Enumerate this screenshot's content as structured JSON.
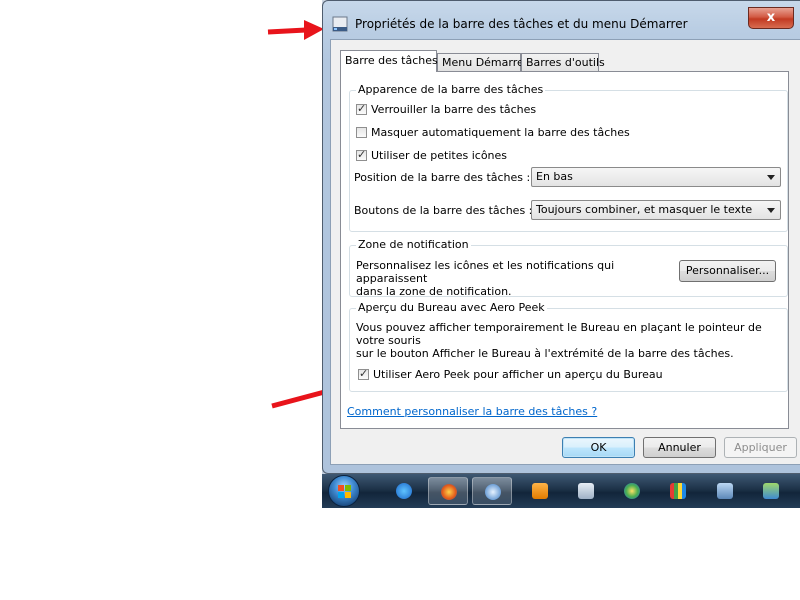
{
  "window": {
    "title": "Propriétés de la barre des tâches et du menu Démarrer",
    "close_label": "x"
  },
  "tabs": [
    {
      "label": "Barre des tâches",
      "active": true
    },
    {
      "label": "Menu Démarrer",
      "active": false
    },
    {
      "label": "Barres d'outils",
      "active": false
    }
  ],
  "appearance": {
    "title": "Apparence de la barre des tâches",
    "lock": {
      "label": "Verrouiller la barre des tâches",
      "checked": true
    },
    "autohide": {
      "label": "Masquer automatiquement la barre des tâches",
      "checked": false
    },
    "small_icons": {
      "label": "Utiliser de petites icônes",
      "checked": true
    },
    "position_label": "Position de la barre des tâches :",
    "position_value": "En bas",
    "buttons_label": "Boutons de la barre des tâches :",
    "buttons_value": "Toujours combiner, et masquer le texte"
  },
  "notification": {
    "title": "Zone de notification",
    "desc_line1": "Personnalisez les icônes et les notifications qui apparaissent",
    "desc_line2": "dans la zone de notification.",
    "customize_button": "Personnaliser..."
  },
  "aero_peek": {
    "title": "Aperçu du Bureau avec Aero Peek",
    "desc_line1": "Vous pouvez afficher temporairement le Bureau en plaçant le pointeur de votre souris",
    "desc_line2": "sur le bouton Afficher le Bureau à l'extrémité de la barre des tâches.",
    "checkbox": {
      "label": "Utiliser Aero Peek pour afficher un aperçu du Bureau",
      "checked": true
    }
  },
  "help_link": "Comment personnaliser la barre des tâches ?",
  "buttons": {
    "ok": "OK",
    "cancel": "Annuler",
    "apply": "Appliquer"
  },
  "colors": {
    "arrow": "#e8141b",
    "link": "#0066cc"
  },
  "taskbar": {
    "icons": [
      "start-orb",
      "internet-explorer-icon",
      "firefox-icon",
      "thunderbird-icon",
      "media-player-icon",
      "calculator-icon",
      "windows-media-icon",
      "games-icon",
      "remote-desktop-icon",
      "network-icon"
    ]
  }
}
